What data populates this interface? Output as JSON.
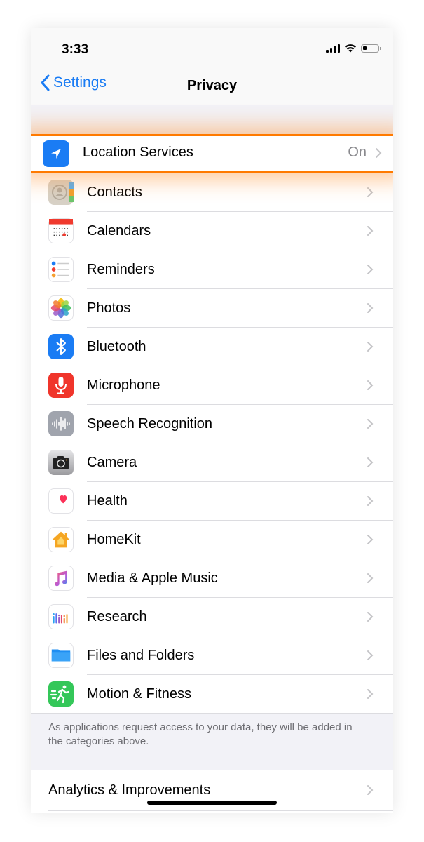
{
  "status_bar": {
    "time": "3:33"
  },
  "nav": {
    "back_label": "Settings",
    "title": "Privacy"
  },
  "location_services": {
    "label": "Location Services",
    "value": "On",
    "icon": "location-arrow-icon"
  },
  "items": [
    {
      "label": "Contacts",
      "icon": "contacts-icon"
    },
    {
      "label": "Calendars",
      "icon": "calendar-icon"
    },
    {
      "label": "Reminders",
      "icon": "reminders-icon"
    },
    {
      "label": "Photos",
      "icon": "photos-icon"
    },
    {
      "label": "Bluetooth",
      "icon": "bluetooth-icon"
    },
    {
      "label": "Microphone",
      "icon": "microphone-icon"
    },
    {
      "label": "Speech Recognition",
      "icon": "speech-waveform-icon"
    },
    {
      "label": "Camera",
      "icon": "camera-icon"
    },
    {
      "label": "Health",
      "icon": "heart-icon"
    },
    {
      "label": "HomeKit",
      "icon": "home-icon"
    },
    {
      "label": "Media & Apple Music",
      "icon": "music-note-icon"
    },
    {
      "label": "Research",
      "icon": "research-icon"
    },
    {
      "label": "Files and Folders",
      "icon": "folder-icon"
    },
    {
      "label": "Motion & Fitness",
      "icon": "running-figure-icon"
    }
  ],
  "footer_note": "As applications request access to your data, they will be added in the categories above.",
  "analytics": {
    "label": "Analytics & Improvements"
  },
  "colors": {
    "accent": "#1a7cf4",
    "highlight": "#ff7a00"
  }
}
